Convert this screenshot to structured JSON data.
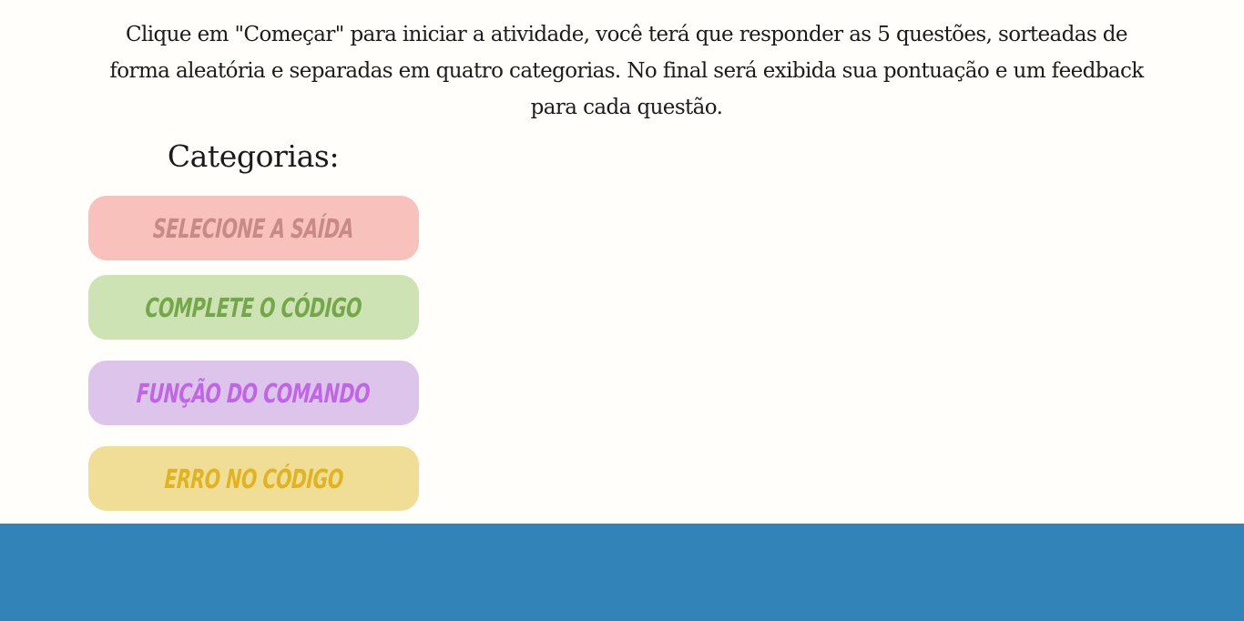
{
  "intro": {
    "text": "Clique em \"Começar\" para iniciar a atividade, você terá que responder as 5 questões, sorteadas de forma aleatória e separadas em quatro categorias. No final será exibida sua pontuação e um feedback para cada questão."
  },
  "categories": {
    "title": "Categorias:",
    "items": [
      {
        "label": "SELECIONE A SAÍDA",
        "bg": "#f8c1bb",
        "color": "#c88a87"
      },
      {
        "label": "COMPLETE O CÓDIGO",
        "bg": "#cde3b4",
        "color": "#74a749"
      },
      {
        "label": "FUNÇÃO DO COMANDO",
        "bg": "#dcc4ea",
        "color": "#c065e8"
      },
      {
        "label": "ERRO NO CÓDIGO",
        "bg": "#f0de97",
        "color": "#e0b421"
      }
    ]
  },
  "footer": {
    "color": "#3183b8"
  }
}
